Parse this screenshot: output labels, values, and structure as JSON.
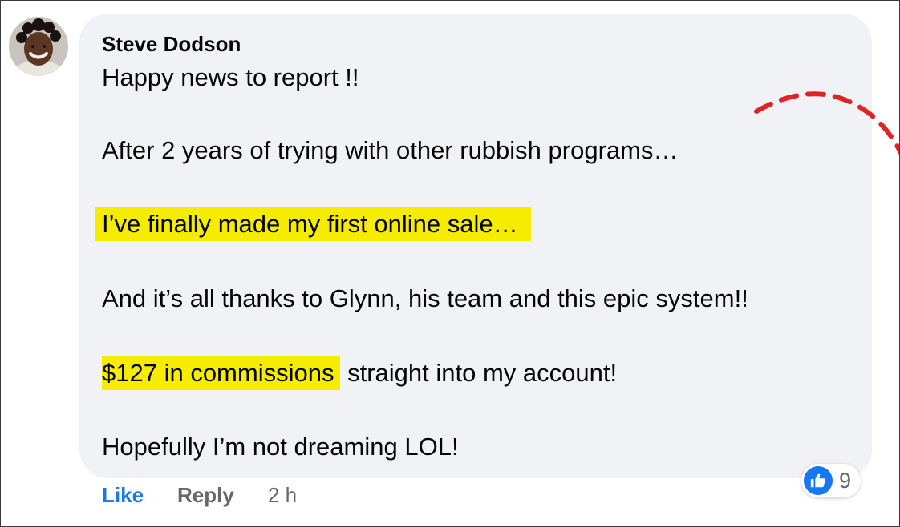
{
  "comment": {
    "author": "Steve Dodson",
    "lines": [
      "Happy news to report !!",
      "After 2 years of trying with other rubbish programs…",
      "I’ve finally made my first online sale…",
      "And it’s all thanks to Glynn, his team and this epic system!!",
      "$127 in commissions",
      " straight into my account!",
      "Hopefully I’m not dreaming LOL!"
    ]
  },
  "highlight_color": "#f5ec00",
  "reactions": {
    "icon": "thumbs-up-icon",
    "count": "9",
    "color": "#1877f2"
  },
  "actions": {
    "like_label": "Like",
    "reply_label": "Reply",
    "timestamp": "2 h"
  },
  "decoration": {
    "arc_color": "#e02424",
    "arc_style": "dashed"
  }
}
